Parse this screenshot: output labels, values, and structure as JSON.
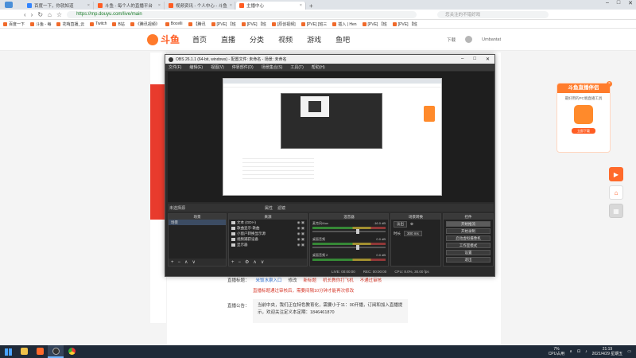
{
  "browser": {
    "tabs": [
      {
        "label": "百度一下，你就知道",
        "color": "#3385ff",
        "active": false
      },
      {
        "label": "斗鱼 - 每个人的直播平台",
        "color": "#ff5d23",
        "active": false
      },
      {
        "label": "视频资讯 - 个人中心 - 斗鱼",
        "color": "#ff5d23",
        "active": false
      },
      {
        "label": "主播中心",
        "color": "#ff5d23",
        "active": true
      }
    ],
    "new_tab": "+",
    "url": "https://mp.douyu.com/live/main",
    "search_placeholder": "您关注的不错好戏",
    "bookmarks": [
      "百度一下",
      "斗鱼 - 每",
      "花哨直播_云",
      "Twitch",
      "B站",
      "《腾讯视频》",
      "Bocelli",
      "【腾讯",
      "[PVE] 【班",
      "[PVE] 【班",
      "[原创视频]",
      "[PVE] [班三",
      "插入 | Hen",
      "[PVE] 【班",
      "[PVE] 【班"
    ]
  },
  "douyu": {
    "logo_text": "斗鱼",
    "nav": [
      "首页",
      "直播",
      "分类",
      "视频",
      "游戏",
      "鱼吧"
    ],
    "user_links": [
      "下载",
      "Umbantat"
    ],
    "form": {
      "title_label": "直播标题：",
      "title_value": "米饭水泉入口",
      "modify": "修改",
      "new_link": "新标题",
      "link2": "机长教你打飞机",
      "link3": "不通过审核",
      "warning": "直播标题通过审核后，需要间隔10分钟才能再次修改",
      "notice_label": "直播公告：",
      "notice_text": "当前中央，我们正在特色教育化，需要小于11：00开播，订阅和加入直播提示，欢迎关注定义本定期：1846461870"
    },
    "promo": {
      "title": "斗鱼直播伴侣",
      "subtitle": "最好用的PC端直播工具",
      "button": "立即下载"
    }
  },
  "obs": {
    "title": "OBS 26.1.1 (64-bit, windows) - 配置文件: 未命名 - 场景: 未命名",
    "menu": [
      "文件(F)",
      "编辑(E)",
      "视图(V)",
      "停靠部件(D)",
      "场景集合(S)",
      "工具(T)",
      "帮助(H)"
    ],
    "scene_label": "未选择源",
    "props_button": "属性",
    "filter_button": "滤镜",
    "panels": {
      "scenes": {
        "header": "场景",
        "items": [
          "场景"
        ]
      },
      "sources": {
        "header": "来源",
        "items": [
          "文本 (GDI+)",
          "歌曲显示-歌曲",
          "小窗户转换显示源",
          "视频捕获设备",
          "显示器"
        ]
      },
      "mixer": {
        "header": "混音器",
        "channels": [
          {
            "name": "麦克风/Aux",
            "db": "-16.0 dB"
          },
          {
            "name": "桌面音频",
            "db": "0.0 dB"
          },
          {
            "name": "桌面音频 2",
            "db": "0.0 dB"
          }
        ]
      },
      "transitions": {
        "header": "场景转换",
        "type": "淡出",
        "duration_label": "时长",
        "duration": "300 ms"
      },
      "controls": {
        "header": "控件",
        "buttons": [
          "开始推流",
          "开始录制",
          "启动虚拟摄像机",
          "工作室模式",
          "设置",
          "退出"
        ]
      }
    },
    "status": [
      "LIVE: 00:00:00",
      "REC: 00:00:00",
      "CPU: 8.0%, 30.00 fps"
    ]
  },
  "taskbar": {
    "time": "21:19",
    "date": "2021/4/29 星期五",
    "cpu": "7%",
    "cpu_label": "CPU占用"
  }
}
